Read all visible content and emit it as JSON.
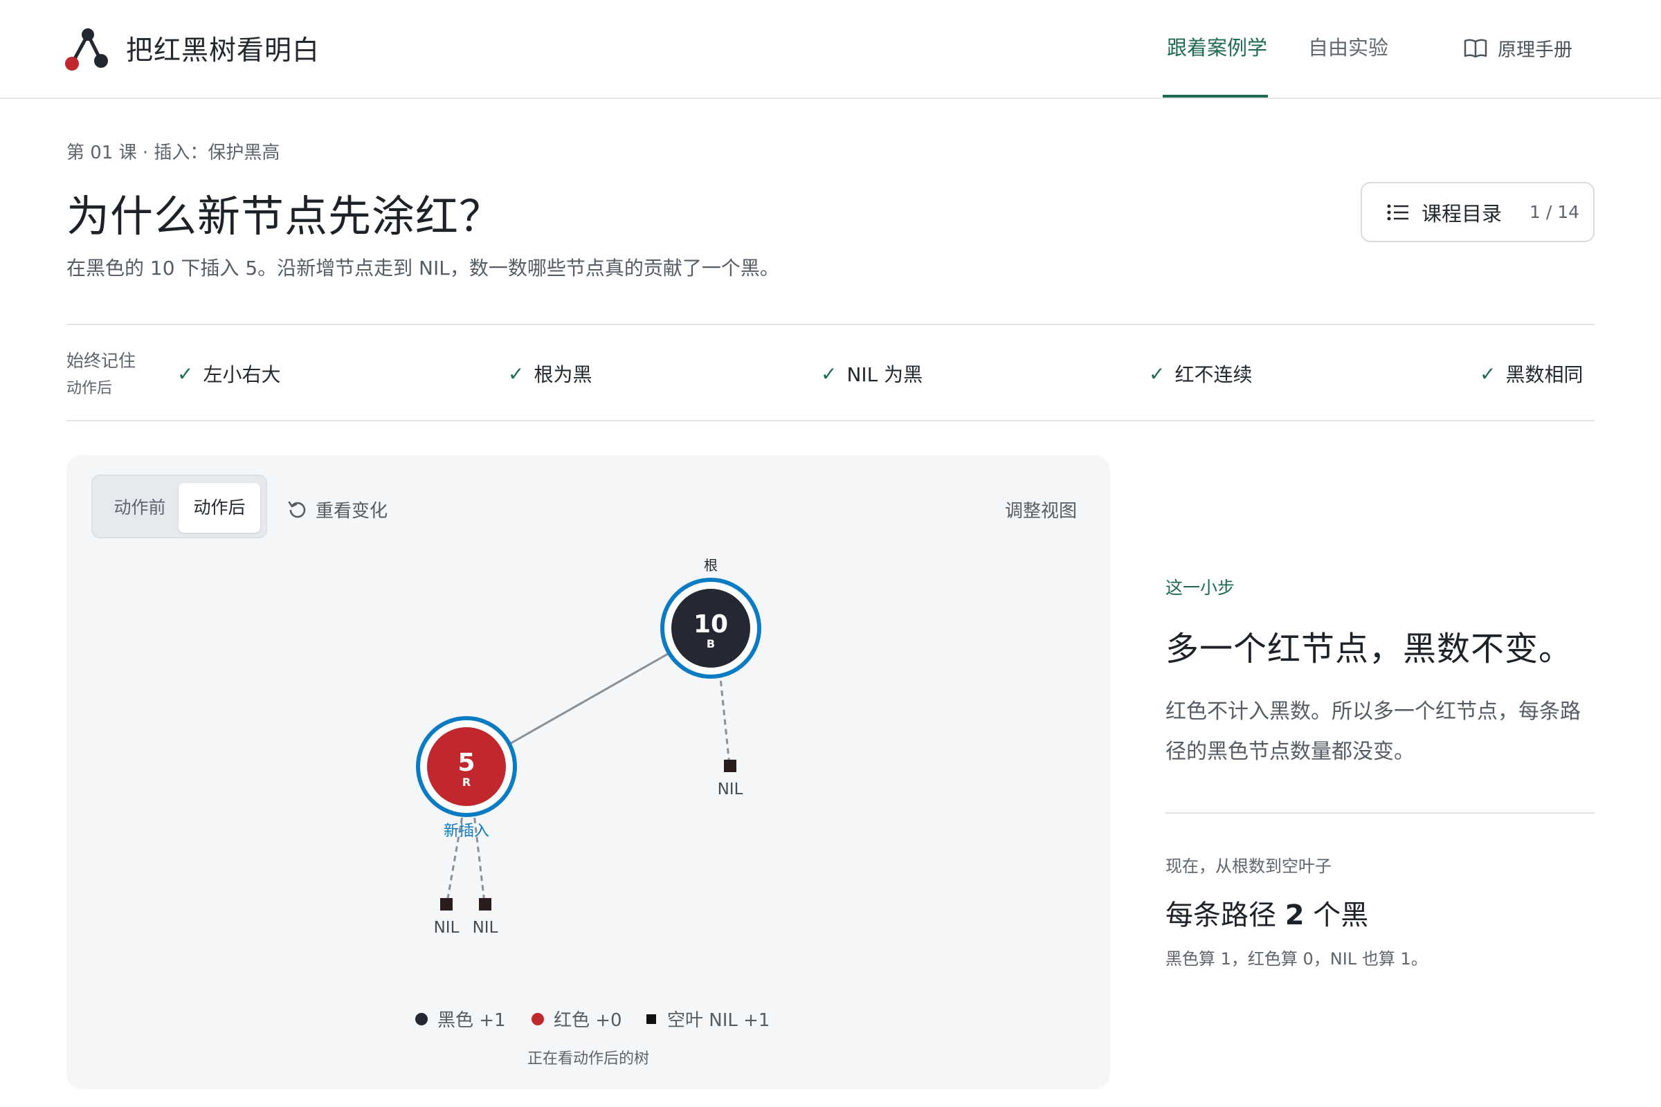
{
  "app": {
    "brand": "把红黑树看明白",
    "nav": [
      {
        "label": "跟着案例学"
      },
      {
        "label": "自由实验"
      }
    ],
    "manual_label": "原理手册"
  },
  "lesson": {
    "crumb": "第 01 课 · 插入：保护黑高",
    "title": "为什么新节点先涂红？",
    "subtitle": "在黑色的 10 下插入 5。沿新增节点走到 NIL，数一数哪些节点真的贡献了一个黑。",
    "toc_label": "课程目录",
    "toc_count": "1 / 14"
  },
  "rules": {
    "remember_label": "始终记住",
    "remember_sub": "动作后",
    "items": [
      {
        "label": "左小右大"
      },
      {
        "label": "根为黑"
      },
      {
        "label": "NIL 为黑"
      },
      {
        "label": "红不连续"
      },
      {
        "label": "黑数相同"
      }
    ]
  },
  "viewer": {
    "before_label": "动作前",
    "after_label": "动作后",
    "replay_label": "重看变化",
    "adjust_label": "调整视图",
    "root_label": "根",
    "new_label": "新插入",
    "nodes": [
      {
        "key": "10",
        "color_tag": "B"
      },
      {
        "key": "5",
        "color_tag": "R"
      }
    ],
    "nil_label": "NIL",
    "legend": [
      {
        "label": "黑色 +1"
      },
      {
        "label": "红色 +0"
      },
      {
        "label": "空叶 NIL +1"
      }
    ],
    "viewing_label": "正在看动作后的树"
  },
  "step": {
    "kicker": "这一小步",
    "headline": "多一个红节点，黑数不变。",
    "body": "红色不计入黑数。所以多一个红节点，每条路径的黑色节点数量都没变。",
    "now_kicker": "现在，从根数到空叶子",
    "now_prefix": "每条路径 ",
    "now_number": "2",
    "now_suffix": " 个黑",
    "note": "黑色算 1，红色算 0，NIL 也算 1。"
  },
  "colors": {
    "accent_green": "#1f6b4f",
    "black_node": "#232833",
    "red_node": "#c0282d",
    "highlight_ring": "#0b7bc4"
  }
}
